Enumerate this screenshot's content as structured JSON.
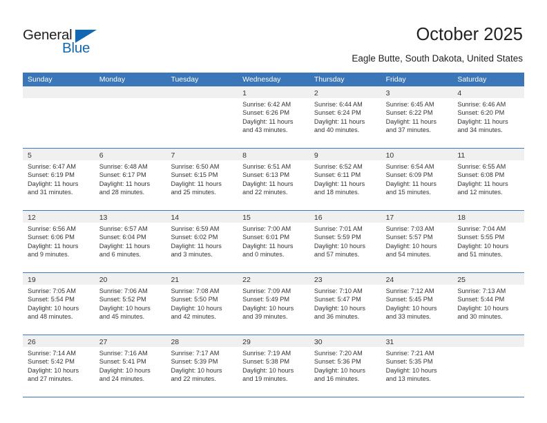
{
  "brand": {
    "word_one": "General",
    "word_two": "Blue",
    "triangle_color": "#1268b3",
    "text_color": "#231f20"
  },
  "header": {
    "title": "October 2025",
    "subtitle": "Eagle Butte, South Dakota, United States"
  },
  "theme": {
    "header_blue": "#3a76b8",
    "day_band_gray": "#f0f0f0",
    "text_color": "#333333"
  },
  "weekdays": [
    "Sunday",
    "Monday",
    "Tuesday",
    "Wednesday",
    "Thursday",
    "Friday",
    "Saturday"
  ],
  "weeks": [
    [
      {
        "day": "",
        "sunrise": "",
        "sunset": "",
        "daylight_1": "",
        "daylight_2": "",
        "empty": true
      },
      {
        "day": "",
        "sunrise": "",
        "sunset": "",
        "daylight_1": "",
        "daylight_2": "",
        "empty": true
      },
      {
        "day": "",
        "sunrise": "",
        "sunset": "",
        "daylight_1": "",
        "daylight_2": "",
        "empty": true
      },
      {
        "day": "1",
        "sunrise": "Sunrise: 6:42 AM",
        "sunset": "Sunset: 6:26 PM",
        "daylight_1": "Daylight: 11 hours",
        "daylight_2": "and 43 minutes."
      },
      {
        "day": "2",
        "sunrise": "Sunrise: 6:44 AM",
        "sunset": "Sunset: 6:24 PM",
        "daylight_1": "Daylight: 11 hours",
        "daylight_2": "and 40 minutes."
      },
      {
        "day": "3",
        "sunrise": "Sunrise: 6:45 AM",
        "sunset": "Sunset: 6:22 PM",
        "daylight_1": "Daylight: 11 hours",
        "daylight_2": "and 37 minutes."
      },
      {
        "day": "4",
        "sunrise": "Sunrise: 6:46 AM",
        "sunset": "Sunset: 6:20 PM",
        "daylight_1": "Daylight: 11 hours",
        "daylight_2": "and 34 minutes."
      }
    ],
    [
      {
        "day": "5",
        "sunrise": "Sunrise: 6:47 AM",
        "sunset": "Sunset: 6:19 PM",
        "daylight_1": "Daylight: 11 hours",
        "daylight_2": "and 31 minutes."
      },
      {
        "day": "6",
        "sunrise": "Sunrise: 6:48 AM",
        "sunset": "Sunset: 6:17 PM",
        "daylight_1": "Daylight: 11 hours",
        "daylight_2": "and 28 minutes."
      },
      {
        "day": "7",
        "sunrise": "Sunrise: 6:50 AM",
        "sunset": "Sunset: 6:15 PM",
        "daylight_1": "Daylight: 11 hours",
        "daylight_2": "and 25 minutes."
      },
      {
        "day": "8",
        "sunrise": "Sunrise: 6:51 AM",
        "sunset": "Sunset: 6:13 PM",
        "daylight_1": "Daylight: 11 hours",
        "daylight_2": "and 22 minutes."
      },
      {
        "day": "9",
        "sunrise": "Sunrise: 6:52 AM",
        "sunset": "Sunset: 6:11 PM",
        "daylight_1": "Daylight: 11 hours",
        "daylight_2": "and 18 minutes."
      },
      {
        "day": "10",
        "sunrise": "Sunrise: 6:54 AM",
        "sunset": "Sunset: 6:09 PM",
        "daylight_1": "Daylight: 11 hours",
        "daylight_2": "and 15 minutes."
      },
      {
        "day": "11",
        "sunrise": "Sunrise: 6:55 AM",
        "sunset": "Sunset: 6:08 PM",
        "daylight_1": "Daylight: 11 hours",
        "daylight_2": "and 12 minutes."
      }
    ],
    [
      {
        "day": "12",
        "sunrise": "Sunrise: 6:56 AM",
        "sunset": "Sunset: 6:06 PM",
        "daylight_1": "Daylight: 11 hours",
        "daylight_2": "and 9 minutes."
      },
      {
        "day": "13",
        "sunrise": "Sunrise: 6:57 AM",
        "sunset": "Sunset: 6:04 PM",
        "daylight_1": "Daylight: 11 hours",
        "daylight_2": "and 6 minutes."
      },
      {
        "day": "14",
        "sunrise": "Sunrise: 6:59 AM",
        "sunset": "Sunset: 6:02 PM",
        "daylight_1": "Daylight: 11 hours",
        "daylight_2": "and 3 minutes."
      },
      {
        "day": "15",
        "sunrise": "Sunrise: 7:00 AM",
        "sunset": "Sunset: 6:01 PM",
        "daylight_1": "Daylight: 11 hours",
        "daylight_2": "and 0 minutes."
      },
      {
        "day": "16",
        "sunrise": "Sunrise: 7:01 AM",
        "sunset": "Sunset: 5:59 PM",
        "daylight_1": "Daylight: 10 hours",
        "daylight_2": "and 57 minutes."
      },
      {
        "day": "17",
        "sunrise": "Sunrise: 7:03 AM",
        "sunset": "Sunset: 5:57 PM",
        "daylight_1": "Daylight: 10 hours",
        "daylight_2": "and 54 minutes."
      },
      {
        "day": "18",
        "sunrise": "Sunrise: 7:04 AM",
        "sunset": "Sunset: 5:55 PM",
        "daylight_1": "Daylight: 10 hours",
        "daylight_2": "and 51 minutes."
      }
    ],
    [
      {
        "day": "19",
        "sunrise": "Sunrise: 7:05 AM",
        "sunset": "Sunset: 5:54 PM",
        "daylight_1": "Daylight: 10 hours",
        "daylight_2": "and 48 minutes."
      },
      {
        "day": "20",
        "sunrise": "Sunrise: 7:06 AM",
        "sunset": "Sunset: 5:52 PM",
        "daylight_1": "Daylight: 10 hours",
        "daylight_2": "and 45 minutes."
      },
      {
        "day": "21",
        "sunrise": "Sunrise: 7:08 AM",
        "sunset": "Sunset: 5:50 PM",
        "daylight_1": "Daylight: 10 hours",
        "daylight_2": "and 42 minutes."
      },
      {
        "day": "22",
        "sunrise": "Sunrise: 7:09 AM",
        "sunset": "Sunset: 5:49 PM",
        "daylight_1": "Daylight: 10 hours",
        "daylight_2": "and 39 minutes."
      },
      {
        "day": "23",
        "sunrise": "Sunrise: 7:10 AM",
        "sunset": "Sunset: 5:47 PM",
        "daylight_1": "Daylight: 10 hours",
        "daylight_2": "and 36 minutes."
      },
      {
        "day": "24",
        "sunrise": "Sunrise: 7:12 AM",
        "sunset": "Sunset: 5:45 PM",
        "daylight_1": "Daylight: 10 hours",
        "daylight_2": "and 33 minutes."
      },
      {
        "day": "25",
        "sunrise": "Sunrise: 7:13 AM",
        "sunset": "Sunset: 5:44 PM",
        "daylight_1": "Daylight: 10 hours",
        "daylight_2": "and 30 minutes."
      }
    ],
    [
      {
        "day": "26",
        "sunrise": "Sunrise: 7:14 AM",
        "sunset": "Sunset: 5:42 PM",
        "daylight_1": "Daylight: 10 hours",
        "daylight_2": "and 27 minutes."
      },
      {
        "day": "27",
        "sunrise": "Sunrise: 7:16 AM",
        "sunset": "Sunset: 5:41 PM",
        "daylight_1": "Daylight: 10 hours",
        "daylight_2": "and 24 minutes."
      },
      {
        "day": "28",
        "sunrise": "Sunrise: 7:17 AM",
        "sunset": "Sunset: 5:39 PM",
        "daylight_1": "Daylight: 10 hours",
        "daylight_2": "and 22 minutes."
      },
      {
        "day": "29",
        "sunrise": "Sunrise: 7:19 AM",
        "sunset": "Sunset: 5:38 PM",
        "daylight_1": "Daylight: 10 hours",
        "daylight_2": "and 19 minutes."
      },
      {
        "day": "30",
        "sunrise": "Sunrise: 7:20 AM",
        "sunset": "Sunset: 5:36 PM",
        "daylight_1": "Daylight: 10 hours",
        "daylight_2": "and 16 minutes."
      },
      {
        "day": "31",
        "sunrise": "Sunrise: 7:21 AM",
        "sunset": "Sunset: 5:35 PM",
        "daylight_1": "Daylight: 10 hours",
        "daylight_2": "and 13 minutes."
      },
      {
        "day": "",
        "sunrise": "",
        "sunset": "",
        "daylight_1": "",
        "daylight_2": "",
        "empty": true
      }
    ]
  ]
}
